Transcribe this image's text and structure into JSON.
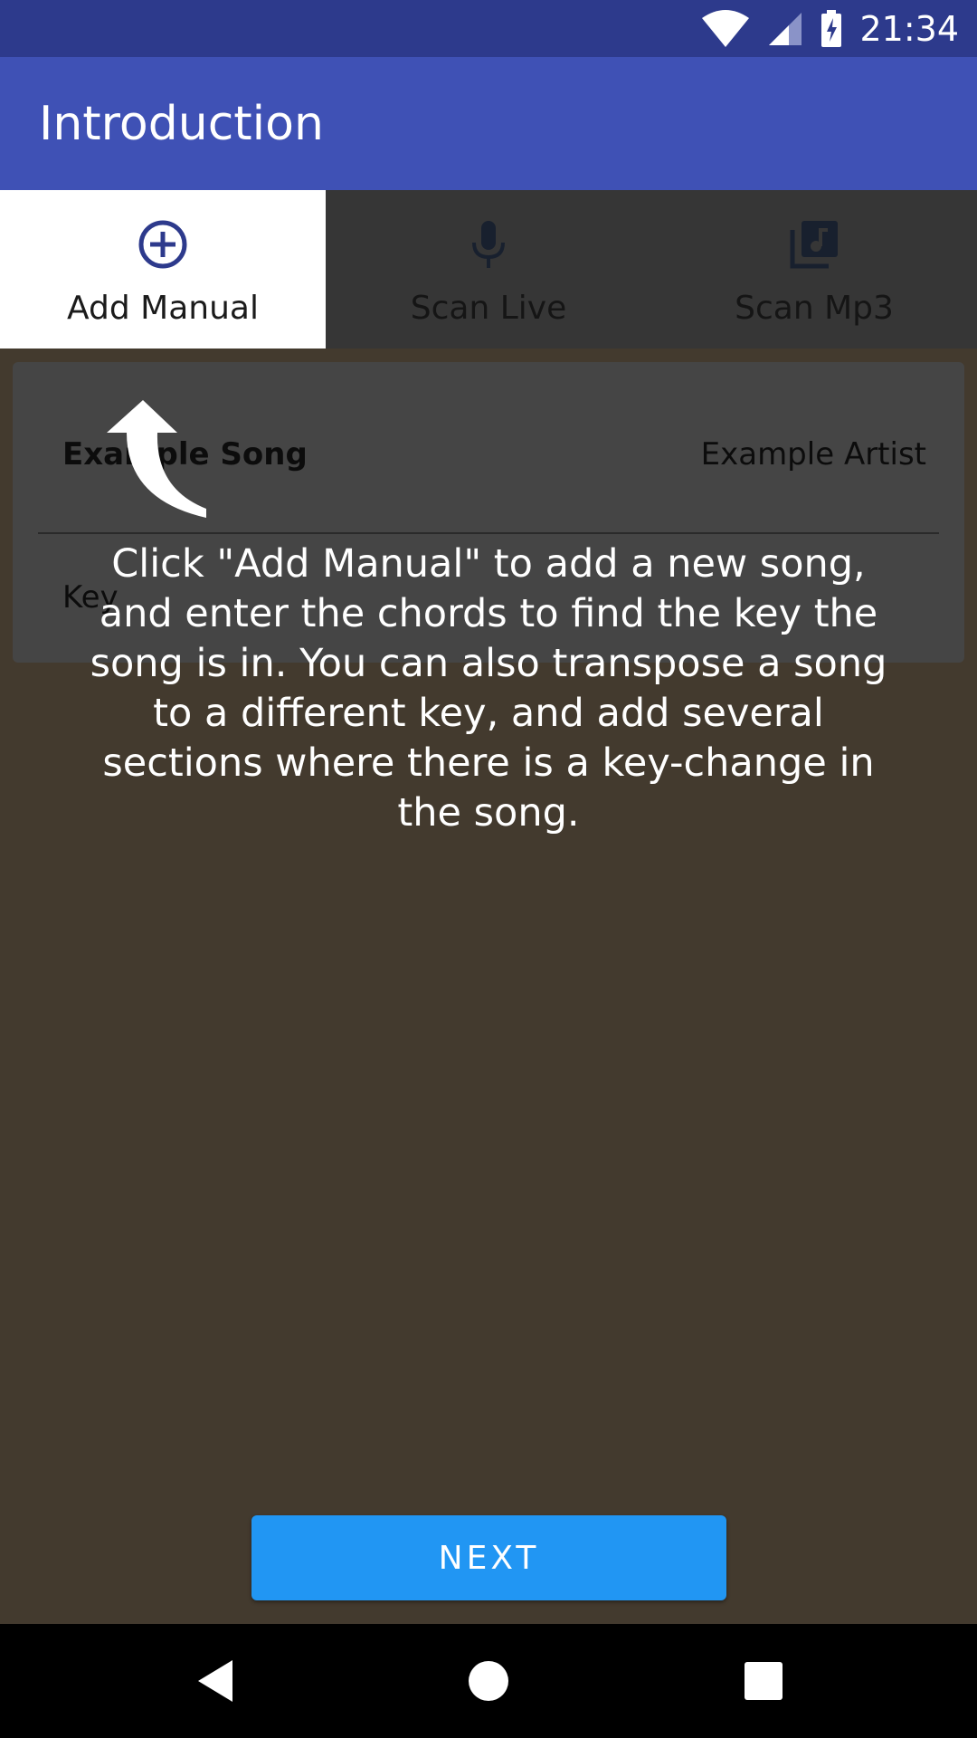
{
  "status_bar": {
    "time": "21:34"
  },
  "app_bar": {
    "title": "Introduction"
  },
  "tabs": [
    {
      "label": "Add Manual",
      "icon": "add-circle-icon",
      "active": true
    },
    {
      "label": "Scan Live",
      "icon": "microphone-icon",
      "active": false
    },
    {
      "label": "Scan Mp3",
      "icon": "music-library-icon",
      "active": false
    }
  ],
  "card": {
    "song_title": "Example Song",
    "artist": "Example Artist",
    "key_label": "Key"
  },
  "overlay": {
    "help_text": "Click \"Add Manual\" to add a new song, and enter the chords to find the key the song is in.  You can also transpose a song to a different key, and add several sections where there is a key-change in the song."
  },
  "next_button": {
    "label": "NEXT"
  },
  "colors": {
    "status_bar": "#2d3a8c",
    "app_bar": "#3f51b5",
    "accent_button": "#2196f3",
    "dim_background": "#433a2e"
  }
}
